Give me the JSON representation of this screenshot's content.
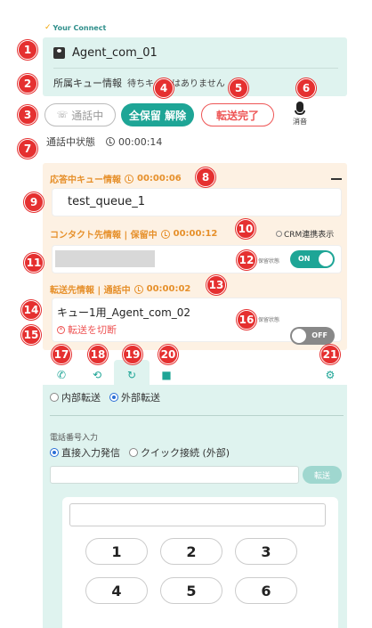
{
  "logo": {
    "text": "Your Connect"
  },
  "agent": {
    "name": "Agent_com_01",
    "queue_label": "所属キュー情報",
    "queue_value": "待ちキューはありません"
  },
  "controls": {
    "call_label": "通話中",
    "hold_label": "全保留 解除",
    "done_label": "転送完了",
    "mute_label": "消音"
  },
  "status": {
    "label": "通話中状態",
    "time": "00:00:14"
  },
  "active_queue": {
    "title": "応答中キュー情報",
    "time": "00:00:06",
    "queue_name": "test_queue_1"
  },
  "contact": {
    "title": "コンタクト先情報 | 保留中",
    "time": "00:00:12",
    "crm_label": "CRM連携表示",
    "hold_status_label": "保留状態",
    "toggle": "ON"
  },
  "transfer": {
    "title": "転送先情報 | 通話中",
    "time": "00:00:02",
    "target": "キュー1用_Agent_com_02",
    "cut_label": "転送を切断",
    "hold_status_label": "保留状態",
    "toggle": "OFF"
  },
  "tabs": [
    "phone",
    "history",
    "transfer",
    "video",
    "settings"
  ],
  "dialer": {
    "internal_label": "内部転送",
    "external_label": "外部転送",
    "phone_input_label": "電話番号入力",
    "direct_label": "直接入力発信",
    "quick_label": "クイック接続 (外部)",
    "transfer_btn": "転送",
    "keys": [
      "1",
      "2",
      "3",
      "4",
      "5",
      "6"
    ]
  },
  "markers": [
    "1",
    "2",
    "3",
    "4",
    "5",
    "6",
    "7",
    "8",
    "9",
    "10",
    "11",
    "12",
    "13",
    "14",
    "15",
    "16",
    "17",
    "18",
    "19",
    "20",
    "21"
  ]
}
